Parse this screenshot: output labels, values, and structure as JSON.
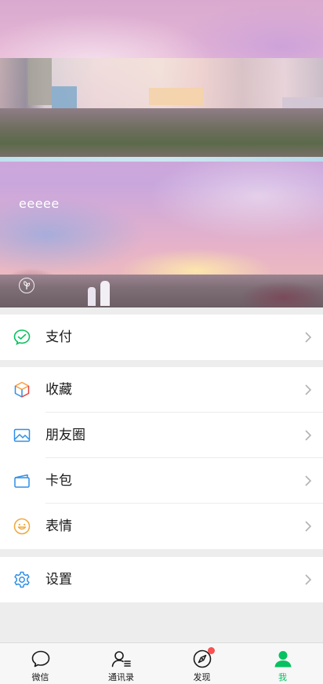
{
  "profile": {
    "username": "eeeee"
  },
  "menu": {
    "group1": [
      {
        "label": "支付",
        "icon": "wechat-pay-icon"
      }
    ],
    "group2": [
      {
        "label": "收藏",
        "icon": "favorites-cube-icon"
      },
      {
        "label": "朋友圈",
        "icon": "moments-photo-icon"
      },
      {
        "label": "卡包",
        "icon": "card-wallet-icon"
      },
      {
        "label": "表情",
        "icon": "sticker-smile-icon"
      }
    ],
    "group3": [
      {
        "label": "设置",
        "icon": "settings-gear-icon"
      }
    ]
  },
  "tabbar": {
    "tabs": [
      {
        "label": "微信",
        "icon": "chat-bubble-icon",
        "active": false
      },
      {
        "label": "通讯录",
        "icon": "contacts-icon",
        "active": false
      },
      {
        "label": "发现",
        "icon": "discover-compass-icon",
        "active": false,
        "badge": true
      },
      {
        "label": "我",
        "icon": "me-person-icon",
        "active": true
      }
    ]
  },
  "colors": {
    "accent": "#07c160",
    "badge": "#fa5151",
    "background": "#ededed"
  }
}
